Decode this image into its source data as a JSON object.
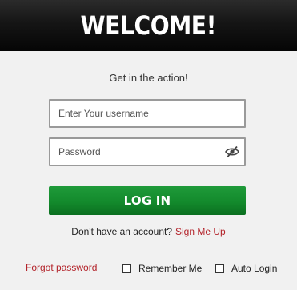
{
  "header": {
    "title": "WELCOME!"
  },
  "form": {
    "tagline": "Get in the action!",
    "username_placeholder": "Enter Your username",
    "password_placeholder": "Password",
    "login_label": "LOG IN"
  },
  "signup": {
    "prompt": "Don't have an account?",
    "link": "Sign Me Up"
  },
  "footer": {
    "forgot_password": "Forgot password",
    "remember_me": "Remember Me",
    "auto_login": "Auto Login"
  },
  "icons": {
    "password_toggle": "eye-slash-icon"
  },
  "colors": {
    "primary_button": "#138a2c",
    "link": "#b3232a",
    "header_bg": "#151515"
  }
}
